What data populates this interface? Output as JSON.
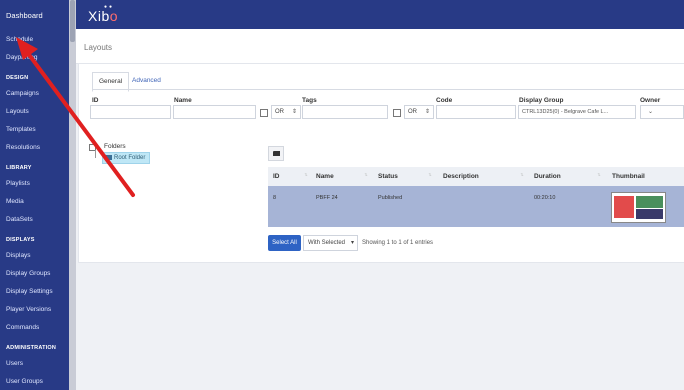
{
  "sidebar": {
    "title": "Dashboard",
    "top_items": [
      {
        "label": "Schedule"
      },
      {
        "label": "Dayparting"
      }
    ],
    "sections": [
      {
        "heading": "DESIGN",
        "items": [
          "Campaigns",
          "Layouts",
          "Templates",
          "Resolutions"
        ]
      },
      {
        "heading": "LIBRARY",
        "items": [
          "Playlists",
          "Media",
          "DataSets"
        ]
      },
      {
        "heading": "DISPLAYS",
        "items": [
          "Displays",
          "Display Groups",
          "Display Settings",
          "Player Versions",
          "Commands"
        ]
      },
      {
        "heading": "ADMINISTRATION",
        "items": [
          "Users",
          "User Groups"
        ]
      }
    ]
  },
  "topbar": {
    "logo_text_1": "Xib",
    "logo_text_2": "o"
  },
  "page": {
    "title": "Layouts"
  },
  "tabs": [
    {
      "label": "General"
    },
    {
      "label": "Advanced"
    }
  ],
  "filters": {
    "id_label": "ID",
    "name_label": "Name",
    "tags_label": "Tags",
    "code_label": "Code",
    "display_group_label": "Display Group",
    "owner_label": "Owner",
    "or_label_1": "OR",
    "or_label_2": "OR",
    "display_group_value": "CTRL13D25(0) - Belgrave Cafe L..."
  },
  "folders": {
    "label": "Folders",
    "root": "Root Folder"
  },
  "table": {
    "headers": [
      "ID",
      "Name",
      "Status",
      "Description",
      "Duration",
      "Thumbnail"
    ],
    "rows": [
      {
        "id": "8",
        "name": "PBFF 24",
        "status": "Published",
        "description": "",
        "duration": "00:20:10"
      }
    ]
  },
  "footer": {
    "select_all": "Select All",
    "with_selected": "With Selected",
    "showing": "Showing 1 to 1 of 1 entries"
  },
  "colors": {
    "brand": "#283a86",
    "selected_row": "#a6b4d6",
    "primary_button": "#2e63c4",
    "annotation_arrow": "#e02020"
  }
}
